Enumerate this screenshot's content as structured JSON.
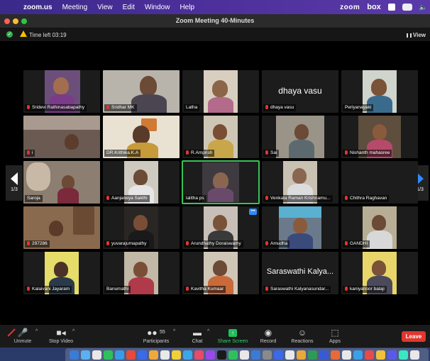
{
  "menubar": {
    "app": "zoom.us",
    "items": [
      "Meeting",
      "View",
      "Edit",
      "Window",
      "Help"
    ],
    "status_zoom": "zoom",
    "status_box": "box"
  },
  "window": {
    "title": "Zoom Meeting  40-Minutes"
  },
  "info": {
    "time_left": "Time left  03:19",
    "view_label": "View"
  },
  "pager": {
    "left_label": "1/3",
    "right_label": "1/3",
    "accent": "#2d8cff"
  },
  "participants": [
    {
      "name": "Sridevi Rathinasabapathy",
      "big": ""
    },
    {
      "name": "Sridhar MK",
      "big": ""
    },
    {
      "name": "Latha",
      "big": ""
    },
    {
      "name": "dhaya vasu",
      "big": "dhaya vasu"
    },
    {
      "name": "Periyanayaki",
      "big": ""
    },
    {
      "name": "i",
      "big": ""
    },
    {
      "name": "DR.Krithika.K.A",
      "big": ""
    },
    {
      "name": "R.Amprish",
      "big": ""
    },
    {
      "name": "Sai",
      "big": ""
    },
    {
      "name": "Nishanth mahasree",
      "big": ""
    },
    {
      "name": "Saroja",
      "big": ""
    },
    {
      "name": "Aanjaneya Sakthi",
      "big": ""
    },
    {
      "name": "lalitha ps",
      "big": ""
    },
    {
      "name": "Venkata Raman Krishnamu...",
      "big": ""
    },
    {
      "name": "Chithra Raghavan",
      "big": ""
    },
    {
      "name": "297286",
      "big": ""
    },
    {
      "name": "yuvarajumapathy",
      "big": ""
    },
    {
      "name": "Arundhathy Doraiswamy",
      "big": ""
    },
    {
      "name": "Amudha",
      "big": ""
    },
    {
      "name": "GANDHI",
      "big": ""
    },
    {
      "name": "Kalaivani Jayaram",
      "big": ""
    },
    {
      "name": "Banumathi",
      "big": ""
    },
    {
      "name": "Kavitha Kumaar",
      "big": ""
    },
    {
      "name": "Saraswathi Kalyanasundar...",
      "big": "Saraswathi Kalya..."
    },
    {
      "name": "kaniyanoor balaji",
      "big": ""
    }
  ],
  "controls": {
    "unmute": "Unmute",
    "stop_video": "Stop Video",
    "participants": "Participants",
    "participants_count": "55",
    "chat": "Chat",
    "share_screen": "Share Screen",
    "record": "Record",
    "reactions": "Reactions",
    "apps": "Apps",
    "leave": "Leave"
  },
  "colors": {
    "active_speaker": "#39c35a",
    "share": "#20c05c",
    "leave": "#e0362f",
    "muted": "#e0362f"
  }
}
